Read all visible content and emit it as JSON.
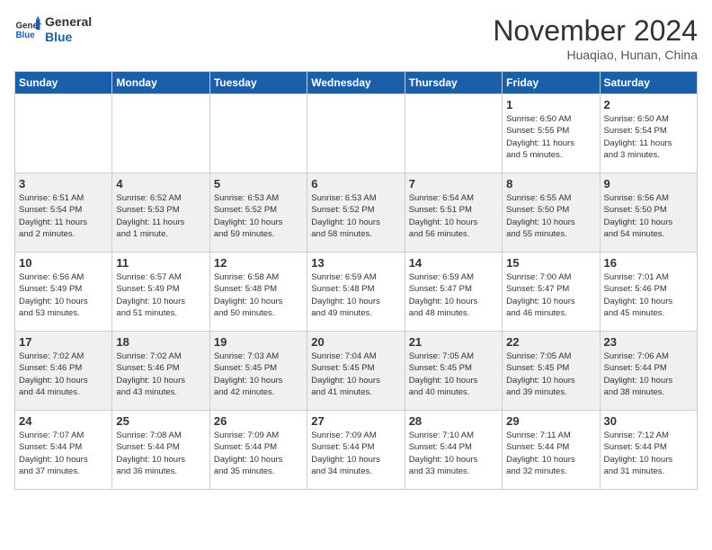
{
  "header": {
    "logo_general": "General",
    "logo_blue": "Blue",
    "month_title": "November 2024",
    "location": "Huaqiao, Hunan, China"
  },
  "weekdays": [
    "Sunday",
    "Monday",
    "Tuesday",
    "Wednesday",
    "Thursday",
    "Friday",
    "Saturday"
  ],
  "weeks": [
    [
      {
        "day": "",
        "info": ""
      },
      {
        "day": "",
        "info": ""
      },
      {
        "day": "",
        "info": ""
      },
      {
        "day": "",
        "info": ""
      },
      {
        "day": "",
        "info": ""
      },
      {
        "day": "1",
        "info": "Sunrise: 6:50 AM\nSunset: 5:55 PM\nDaylight: 11 hours\nand 5 minutes."
      },
      {
        "day": "2",
        "info": "Sunrise: 6:50 AM\nSunset: 5:54 PM\nDaylight: 11 hours\nand 3 minutes."
      }
    ],
    [
      {
        "day": "3",
        "info": "Sunrise: 6:51 AM\nSunset: 5:54 PM\nDaylight: 11 hours\nand 2 minutes."
      },
      {
        "day": "4",
        "info": "Sunrise: 6:52 AM\nSunset: 5:53 PM\nDaylight: 11 hours\nand 1 minute."
      },
      {
        "day": "5",
        "info": "Sunrise: 6:53 AM\nSunset: 5:52 PM\nDaylight: 10 hours\nand 59 minutes."
      },
      {
        "day": "6",
        "info": "Sunrise: 6:53 AM\nSunset: 5:52 PM\nDaylight: 10 hours\nand 58 minutes."
      },
      {
        "day": "7",
        "info": "Sunrise: 6:54 AM\nSunset: 5:51 PM\nDaylight: 10 hours\nand 56 minutes."
      },
      {
        "day": "8",
        "info": "Sunrise: 6:55 AM\nSunset: 5:50 PM\nDaylight: 10 hours\nand 55 minutes."
      },
      {
        "day": "9",
        "info": "Sunrise: 6:56 AM\nSunset: 5:50 PM\nDaylight: 10 hours\nand 54 minutes."
      }
    ],
    [
      {
        "day": "10",
        "info": "Sunrise: 6:56 AM\nSunset: 5:49 PM\nDaylight: 10 hours\nand 53 minutes."
      },
      {
        "day": "11",
        "info": "Sunrise: 6:57 AM\nSunset: 5:49 PM\nDaylight: 10 hours\nand 51 minutes."
      },
      {
        "day": "12",
        "info": "Sunrise: 6:58 AM\nSunset: 5:48 PM\nDaylight: 10 hours\nand 50 minutes."
      },
      {
        "day": "13",
        "info": "Sunrise: 6:59 AM\nSunset: 5:48 PM\nDaylight: 10 hours\nand 49 minutes."
      },
      {
        "day": "14",
        "info": "Sunrise: 6:59 AM\nSunset: 5:47 PM\nDaylight: 10 hours\nand 48 minutes."
      },
      {
        "day": "15",
        "info": "Sunrise: 7:00 AM\nSunset: 5:47 PM\nDaylight: 10 hours\nand 46 minutes."
      },
      {
        "day": "16",
        "info": "Sunrise: 7:01 AM\nSunset: 5:46 PM\nDaylight: 10 hours\nand 45 minutes."
      }
    ],
    [
      {
        "day": "17",
        "info": "Sunrise: 7:02 AM\nSunset: 5:46 PM\nDaylight: 10 hours\nand 44 minutes."
      },
      {
        "day": "18",
        "info": "Sunrise: 7:02 AM\nSunset: 5:46 PM\nDaylight: 10 hours\nand 43 minutes."
      },
      {
        "day": "19",
        "info": "Sunrise: 7:03 AM\nSunset: 5:45 PM\nDaylight: 10 hours\nand 42 minutes."
      },
      {
        "day": "20",
        "info": "Sunrise: 7:04 AM\nSunset: 5:45 PM\nDaylight: 10 hours\nand 41 minutes."
      },
      {
        "day": "21",
        "info": "Sunrise: 7:05 AM\nSunset: 5:45 PM\nDaylight: 10 hours\nand 40 minutes."
      },
      {
        "day": "22",
        "info": "Sunrise: 7:05 AM\nSunset: 5:45 PM\nDaylight: 10 hours\nand 39 minutes."
      },
      {
        "day": "23",
        "info": "Sunrise: 7:06 AM\nSunset: 5:44 PM\nDaylight: 10 hours\nand 38 minutes."
      }
    ],
    [
      {
        "day": "24",
        "info": "Sunrise: 7:07 AM\nSunset: 5:44 PM\nDaylight: 10 hours\nand 37 minutes."
      },
      {
        "day": "25",
        "info": "Sunrise: 7:08 AM\nSunset: 5:44 PM\nDaylight: 10 hours\nand 36 minutes."
      },
      {
        "day": "26",
        "info": "Sunrise: 7:09 AM\nSunset: 5:44 PM\nDaylight: 10 hours\nand 35 minutes."
      },
      {
        "day": "27",
        "info": "Sunrise: 7:09 AM\nSunset: 5:44 PM\nDaylight: 10 hours\nand 34 minutes."
      },
      {
        "day": "28",
        "info": "Sunrise: 7:10 AM\nSunset: 5:44 PM\nDaylight: 10 hours\nand 33 minutes."
      },
      {
        "day": "29",
        "info": "Sunrise: 7:11 AM\nSunset: 5:44 PM\nDaylight: 10 hours\nand 32 minutes."
      },
      {
        "day": "30",
        "info": "Sunrise: 7:12 AM\nSunset: 5:44 PM\nDaylight: 10 hours\nand 31 minutes."
      }
    ]
  ]
}
